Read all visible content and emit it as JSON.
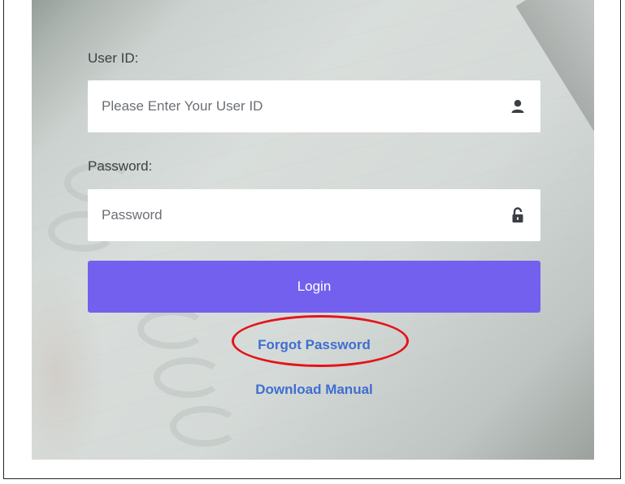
{
  "form": {
    "user_id_label": "User ID:",
    "user_id_placeholder": "Please Enter Your User ID",
    "user_id_value": "",
    "user_icon": "user-icon",
    "password_label": "Password:",
    "password_placeholder": "Password",
    "password_value": "",
    "password_icon": "unlock-icon",
    "login_label": "Login"
  },
  "links": {
    "forgot_password": "Forgot Password",
    "download_manual": "Download Manual"
  },
  "colors": {
    "login_button": "#7460ee",
    "link": "#3f6ed0",
    "highlight": "#e3141c"
  }
}
